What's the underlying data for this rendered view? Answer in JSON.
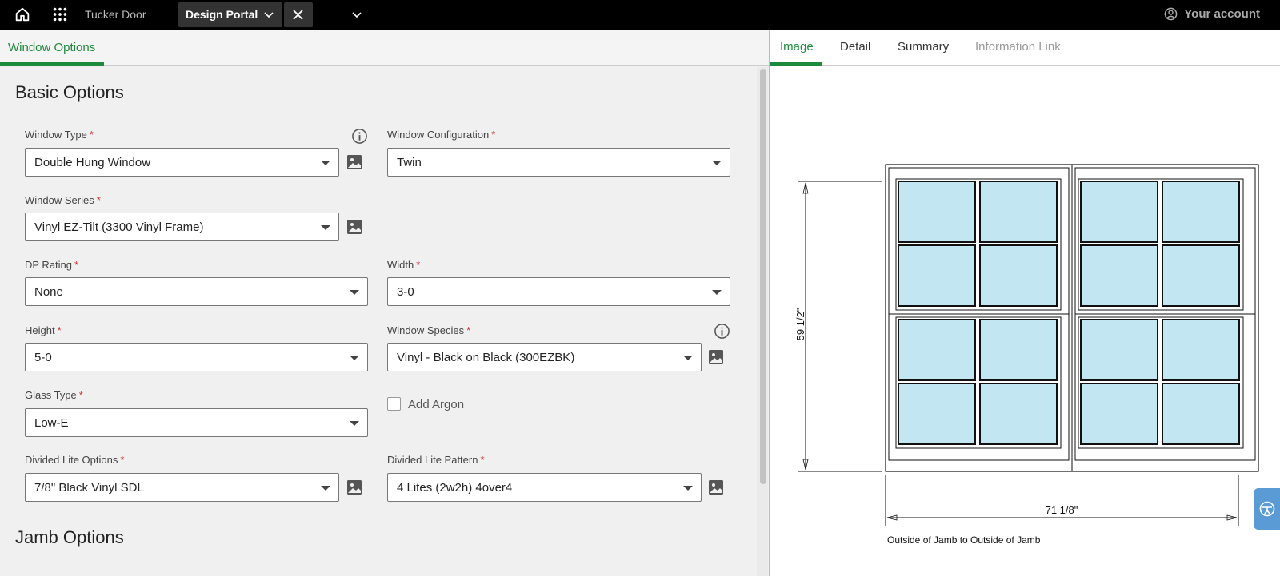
{
  "topbar": {
    "brand": "Tucker Door",
    "active_tab": "Design Portal",
    "account_label": "Your account"
  },
  "left_panel": {
    "tab": "Window Options",
    "sections": {
      "basic": "Basic Options",
      "jamb": "Jamb Options"
    },
    "fields": {
      "window_type": {
        "label": "Window Type",
        "value": "Double Hung Window"
      },
      "window_configuration": {
        "label": "Window Configuration",
        "value": "Twin"
      },
      "window_series": {
        "label": "Window Series",
        "value": "Vinyl EZ-Tilt (3300 Vinyl Frame)"
      },
      "dp_rating": {
        "label": "DP Rating",
        "value": "None"
      },
      "width": {
        "label": "Width",
        "value": "3-0"
      },
      "height": {
        "label": "Height",
        "value": "5-0"
      },
      "window_species": {
        "label": "Window Species",
        "value": "Vinyl - Black on Black (300EZBK)"
      },
      "glass_type": {
        "label": "Glass Type",
        "value": "Low-E"
      },
      "add_argon": {
        "label": "Add Argon",
        "checked": false
      },
      "divided_lite_options": {
        "label": "Divided Lite Options",
        "value": "7/8\" Black Vinyl SDL"
      },
      "divided_lite_pattern": {
        "label": "Divided Lite Pattern",
        "value": "4 Lites (2w2h) 4over4"
      }
    },
    "required_marker": "*"
  },
  "right_panel": {
    "tabs": [
      {
        "label": "Image",
        "active": true
      },
      {
        "label": "Detail"
      },
      {
        "label": "Summary"
      },
      {
        "label": "Information Link",
        "disabled": true
      }
    ],
    "drawing": {
      "height_dim": "59 1/2\"",
      "width_dim": "71 1/8\"",
      "caption": "Outside of Jamb to Outside of Jamb",
      "glass_color": "#c3e6f3"
    }
  },
  "colors": {
    "accent": "#1e8a3c",
    "required": "#d32f2f",
    "topbar_bg": "#000000"
  }
}
